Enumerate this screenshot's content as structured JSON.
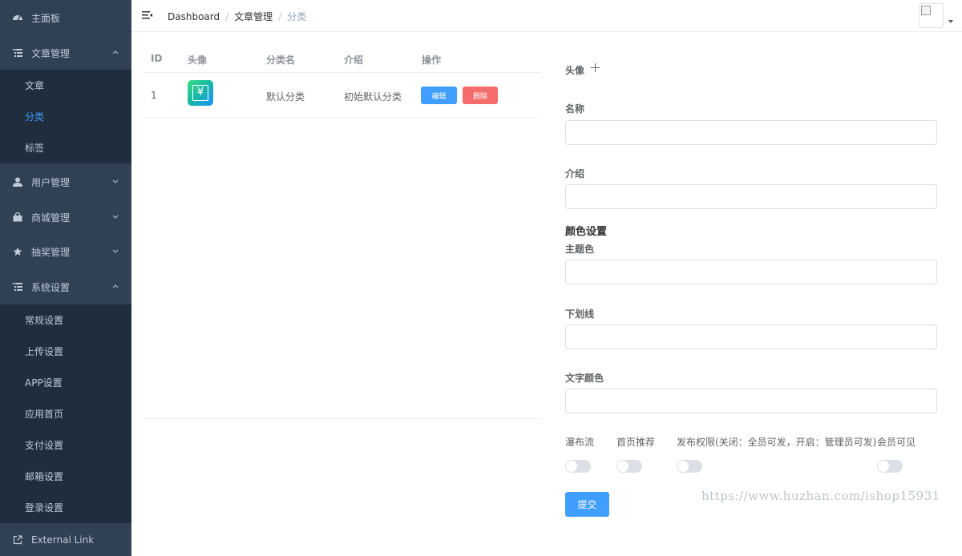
{
  "sidebar": {
    "items": [
      {
        "label": "主面板",
        "icon": "dashboard-icon"
      },
      {
        "label": "文章管理",
        "icon": "list-icon",
        "expanded": true
      },
      {
        "label": "用户管理",
        "icon": "user-icon"
      },
      {
        "label": "商城管理",
        "icon": "shopping-bag-icon"
      },
      {
        "label": "抽奖管理",
        "icon": "star-icon"
      },
      {
        "label": "系统设置",
        "icon": "list-icon",
        "expanded": true
      },
      {
        "label": "External Link",
        "icon": "external-link-icon"
      }
    ],
    "article_sub": [
      "文章",
      "分类",
      "标签"
    ],
    "system_sub": [
      "常规设置",
      "上传设置",
      "APP设置",
      "应用首页",
      "支付设置",
      "邮箱设置",
      "登录设置"
    ]
  },
  "header": {
    "breadcrumb": [
      "Dashboard",
      "文章管理",
      "分类"
    ],
    "separator": "/"
  },
  "table": {
    "columns": [
      "ID",
      "头像",
      "分类名",
      "介绍",
      "操作"
    ],
    "rows": [
      {
        "id": "1",
        "name": "默认分类",
        "intro": "初始默认分类",
        "edit_label": "编辑",
        "delete_label": "删除"
      }
    ]
  },
  "form": {
    "avatar_label": "头像",
    "name_label": "名称",
    "intro_label": "介绍",
    "color_section": "颜色设置",
    "theme_label": "主题色",
    "underline_label": "下划线",
    "text_color_label": "文字颜色",
    "switches": [
      {
        "label": "瀑布流",
        "on": false
      },
      {
        "label": "首页推荐",
        "on": false
      },
      {
        "label": "发布权限(关闭：全员可发，开启：管理员可发)",
        "on": false
      },
      {
        "label": "会员可见",
        "on": false
      }
    ],
    "submit_label": "提交"
  },
  "watermark": "https://www.huzhan.com/ishop15931",
  "colors": {
    "sidebar_bg": "#304156",
    "submenu_bg": "#1f2d3d",
    "accent": "#409eff",
    "danger": "#f56c6c"
  }
}
